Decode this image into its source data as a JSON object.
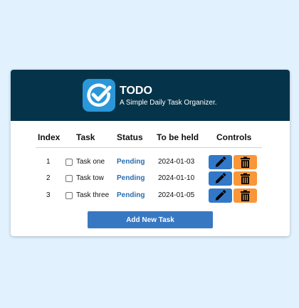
{
  "app": {
    "title": "TODO",
    "subtitle": "A Simple Daily Task Organizer.",
    "logo_icon": "check-circle-icon"
  },
  "table": {
    "columns": [
      "Index",
      "Task",
      "Status",
      "To be held",
      "Controls"
    ],
    "rows": [
      {
        "index": "1",
        "task": "Task one",
        "status": "Pending",
        "date": "2024-01-03",
        "checked": false
      },
      {
        "index": "2",
        "task": "Task tow",
        "status": "Pending",
        "date": "2024-01-10",
        "checked": false
      },
      {
        "index": "3",
        "task": "Task three",
        "status": "Pending",
        "date": "2024-01-05",
        "checked": false
      }
    ],
    "controls": {
      "edit_icon": "pencil-icon",
      "delete_icon": "trash-icon"
    }
  },
  "add_button": {
    "label": "Add New Task"
  },
  "colors": {
    "page_bg": "#e1f2fe",
    "header_bg": "#05344a",
    "logo_bg": "#2b97d9",
    "status_pending": "#2b6cb0",
    "edit_button": "#3278c8",
    "delete_button": "#f99638",
    "add_button": "#3878c2"
  }
}
